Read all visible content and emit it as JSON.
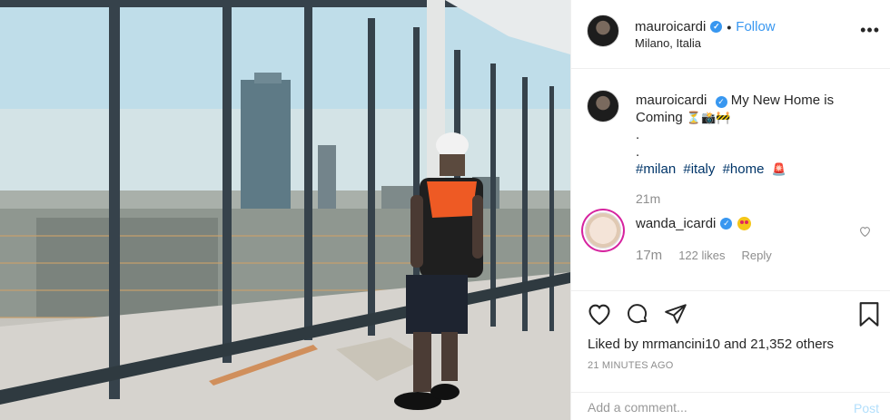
{
  "post": {
    "username": "mauroicardi",
    "follow_label": "Follow",
    "location": "Milano, Italia",
    "more_label": "•••"
  },
  "caption": {
    "username": "mauroicardi",
    "text": "My New Home is Coming",
    "emojis": "⏳📸🚧",
    "dot1": ".",
    "dot2": ".",
    "hashtags": [
      "#milan",
      "#italy",
      "#home"
    ],
    "siren": "🚨",
    "time": "21m"
  },
  "comment": {
    "username": "wanda_icardi",
    "time": "17m",
    "likes": "122 likes",
    "reply": "Reply"
  },
  "actions": {
    "liked_by_prefix": "Liked by",
    "liked_by_user": "mrmancini10",
    "and": "and",
    "others": "21,352 others",
    "ago": "21 MINUTES AGO"
  },
  "add_comment": {
    "placeholder": "Add a comment...",
    "post_label": "Post"
  },
  "colors": {
    "accent": "#3897f0",
    "hashtag": "#003569",
    "muted": "#8e8e8e",
    "post_disabled": "#b2dffc"
  }
}
